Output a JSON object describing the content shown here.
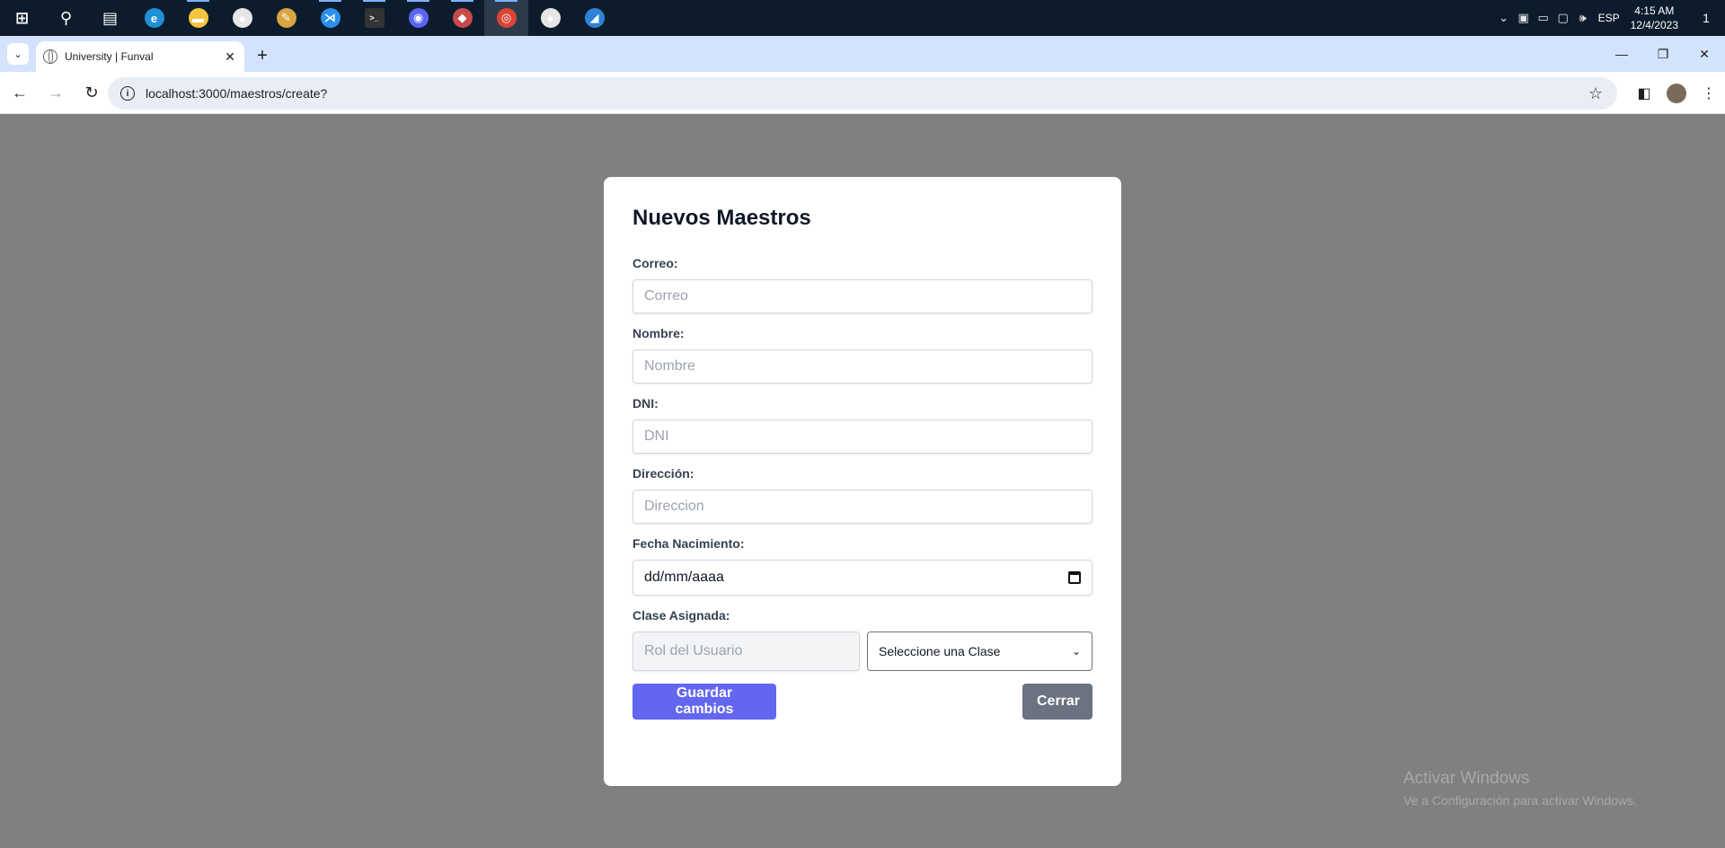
{
  "taskbar": {
    "apps": [
      {
        "name": "windows-start",
        "icon": "windows-icon",
        "color": "#ffffff",
        "glyph": "⊞"
      },
      {
        "name": "search",
        "icon": "search-icon",
        "color": "#ffffff",
        "glyph": "⚲"
      },
      {
        "name": "task-view",
        "icon": "task-view-icon",
        "color": "#ffffff",
        "glyph": "▤"
      },
      {
        "name": "edge",
        "icon": "edge-icon",
        "color": "#1f8fd6",
        "glyph": "e"
      },
      {
        "name": "file-explorer",
        "icon": "folder-icon",
        "color": "#f5c542",
        "glyph": "▬"
      },
      {
        "name": "github-desktop-1",
        "icon": "github-icon",
        "color": "#e6e6e6",
        "glyph": "●"
      },
      {
        "name": "paint",
        "icon": "paint-icon",
        "color": "#d9a441",
        "glyph": "✎"
      },
      {
        "name": "vscode",
        "icon": "vscode-icon",
        "color": "#2a8ff0",
        "glyph": "⋊"
      },
      {
        "name": "terminal",
        "icon": "terminal-icon",
        "color": "#333333",
        "glyph": ">_"
      },
      {
        "name": "discord",
        "icon": "discord-icon",
        "color": "#5865f2",
        "glyph": "◉"
      },
      {
        "name": "app-unknown",
        "icon": "app-icon",
        "color": "#c84a4a",
        "glyph": "◆"
      },
      {
        "name": "chrome",
        "icon": "chrome-icon",
        "color": "#db4437",
        "glyph": "◎"
      },
      {
        "name": "github-desktop-2",
        "icon": "github-icon",
        "color": "#e6e6e6",
        "glyph": "●"
      },
      {
        "name": "azure-data-studio",
        "icon": "azure-icon",
        "color": "#2f83d6",
        "glyph": "◢"
      }
    ],
    "tray": {
      "lang": "ESP",
      "time": "4:15 AM",
      "date": "12/4/2023",
      "notifications": "1"
    }
  },
  "browser": {
    "tab_title": "University | Funval",
    "url": "localhost:3000/maestros/create?"
  },
  "form": {
    "title": "Nuevos Maestros",
    "fields": {
      "correo": {
        "label": "Correo:",
        "placeholder": "Correo"
      },
      "nombre": {
        "label": "Nombre:",
        "placeholder": "Nombre"
      },
      "dni": {
        "label": "DNI:",
        "placeholder": "DNI"
      },
      "direccion": {
        "label": "Dirección:",
        "placeholder": "Direccion"
      },
      "fecha": {
        "label": "Fecha Nacimiento:",
        "value": "dd/mm/aaaa"
      },
      "clase": {
        "label": "Clase Asignada:",
        "rol_placeholder": "Rol del Usuario",
        "select_value": "Seleccione una Clase"
      }
    },
    "save_label": "Guardar cambios",
    "close_label": "Cerrar"
  },
  "watermark": {
    "title": "Activar Windows",
    "subtitle": "Ve a Configuración para activar Windows."
  }
}
